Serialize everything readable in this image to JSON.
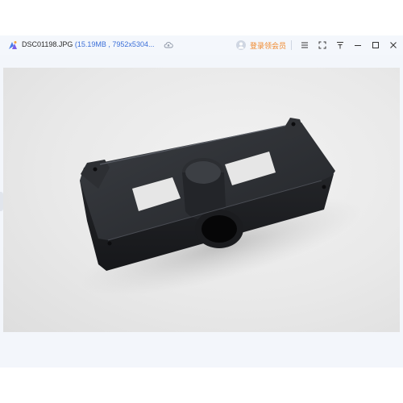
{
  "titlebar": {
    "file_name": "DSC01198.JPG",
    "file_meta": "(15.19MB , 7952x5304...",
    "login_vip": "登录领会员"
  },
  "icons": {
    "app": "app-logo-icon",
    "cloud": "cloud-upload-icon",
    "avatar": "user-avatar-icon",
    "menu": "menu-icon",
    "fullscreen": "fullscreen-icon",
    "pin": "pin-icon",
    "minimize": "minimize-icon",
    "maximize": "maximize-icon",
    "close": "close-icon"
  },
  "colors": {
    "accent_blue": "#3b6fd8",
    "vip_orange": "#f0882b"
  }
}
